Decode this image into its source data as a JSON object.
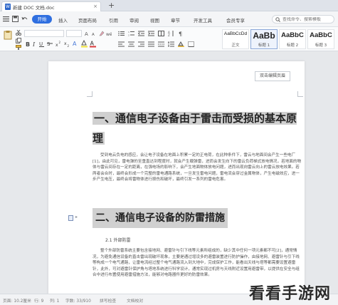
{
  "titlebar": {
    "doc_title": "新建 DOC 文档.doc",
    "close_glyph": "×",
    "new_tab_glyph": "+"
  },
  "menubar": {
    "start_label": "开始",
    "items": [
      "插入",
      "页面布局",
      "引用",
      "审阅",
      "视图",
      "章节",
      "开发工具",
      "会员专享"
    ],
    "search_placeholder": "查找命令、搜索模板"
  },
  "ribbon": {
    "styles": [
      {
        "sample": "AaBbCcDd",
        "name": "正文"
      },
      {
        "sample": "AaBb",
        "name": "标题 1"
      },
      {
        "sample": "AaBbC",
        "name": "标题 2"
      },
      {
        "sample": "AaBbC",
        "name": "标题 3"
      }
    ]
  },
  "document": {
    "edit_badge": "双击编辑页眉",
    "heading1": "一、通信电子设备由于雷击而受损的基本原理",
    "para1": "受到电云负电的感应，会让电子设备在地面上积累一定的正电荷，在此种条件下，雷云与地面间会产生一些电厂[1]，由此可见，雷电弹的至重直达到程度时，就会产生载弹雷，进而会发生向下的雷云负荷梯式放电情况，若地面的物体与雷云间存在一定的距离，在强电场的影响下，会产生地面物体放电问题，进而出现向雷云向上的雷云放电效果。若两者会合时，最终会形成一个完整的雷电通路系统，一旦发生雷电问题，雷电流会穿过金属物体，产生电磁效应，进一步产生电压，最终会将雷物体进行损伤和破坏，最终引发一系列的雷电危害。",
    "heading2": "二、通信电子设备的防雷措施",
    "subheading": "2.1 外部防雷",
    "para2": "整个外部防雷系统主要包含接地网、避雷针与引下线等元素所组成的，缺少其中任何一项元素都不可[2]，通常情况，为避免通信设备的直击雷出现破坏现象，主要是通过增设多的避雷装置进行防护操作，由接地网、避雷针与引下线等构成一个电气通路，让雷电流经过整个电气通路流入到大地中，完成保护工作，能看出天线与塔等都需要设置避雷针，此外，可对避雷针保护角与塔地系统进行科学设计，通常实现过机房与天线附近设置用避雷带，以提供在安全与组合中进行布置使用避雷措施方法，能够对电路器件更好的防雷效果。"
  },
  "statusbar": {
    "items": [
      "页面: 10.2厘米",
      "行: 9",
      "列: 1",
      "字数: 33/910",
      "拼写检查",
      "文档校对"
    ]
  },
  "watermark": "看看手游网"
}
